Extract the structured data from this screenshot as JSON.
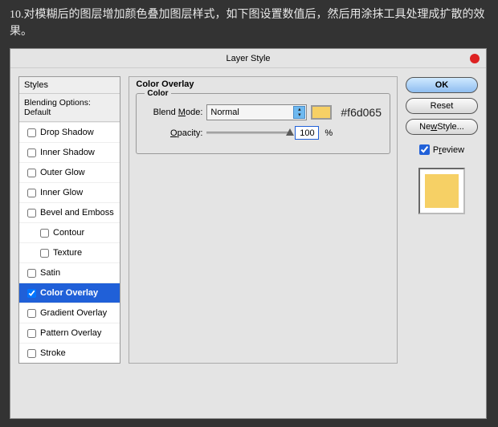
{
  "header_text": "10.对模糊后的图层增加颜色叠加图层样式，如下图设置数值后，然后用涂抹工具处理成扩散的效果。",
  "dialog": {
    "title": "Layer Style"
  },
  "styles": {
    "header": "Styles",
    "blending": "Blending Options: Default",
    "items": [
      {
        "label": "Drop Shadow",
        "checked": false,
        "sub": false
      },
      {
        "label": "Inner Shadow",
        "checked": false,
        "sub": false
      },
      {
        "label": "Outer Glow",
        "checked": false,
        "sub": false
      },
      {
        "label": "Inner Glow",
        "checked": false,
        "sub": false
      },
      {
        "label": "Bevel and Emboss",
        "checked": false,
        "sub": false
      },
      {
        "label": "Contour",
        "checked": false,
        "sub": true
      },
      {
        "label": "Texture",
        "checked": false,
        "sub": true
      },
      {
        "label": "Satin",
        "checked": false,
        "sub": false
      },
      {
        "label": "Color Overlay",
        "checked": true,
        "sub": false,
        "active": true
      },
      {
        "label": "Gradient Overlay",
        "checked": false,
        "sub": false
      },
      {
        "label": "Pattern Overlay",
        "checked": false,
        "sub": false
      },
      {
        "label": "Stroke",
        "checked": false,
        "sub": false
      }
    ]
  },
  "overlay": {
    "title": "Color Overlay",
    "group": "Color",
    "blend_label": "Blend Mode:",
    "blend_value": "Normal",
    "color_hex": "#f6d065",
    "opacity_label": "Opacity:",
    "opacity_prefix": "O",
    "opacity_value": "100",
    "opacity_unit": "%"
  },
  "buttons": {
    "ok": "OK",
    "reset": "Reset",
    "newstyle": "New Style...",
    "preview": "Preview",
    "preview_u": "v"
  },
  "colors": {
    "swatch": "#f6d065"
  }
}
